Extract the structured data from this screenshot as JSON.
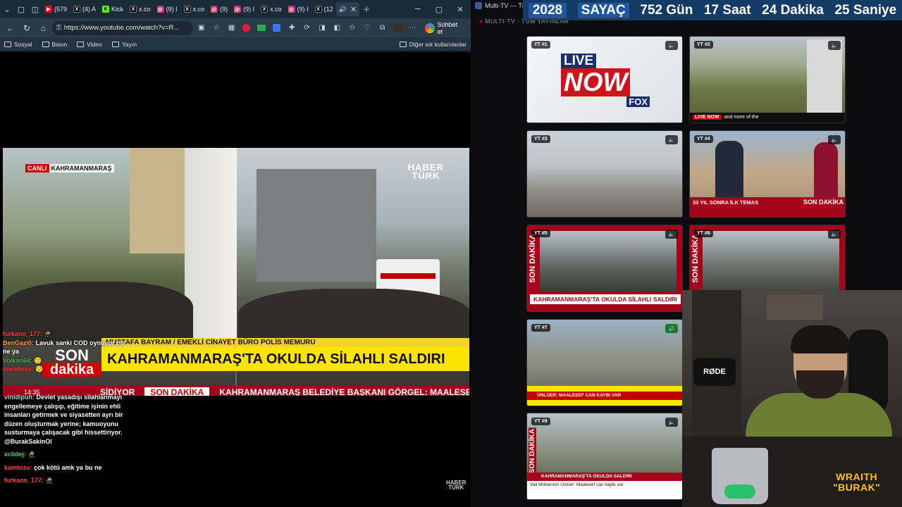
{
  "browser": {
    "tabs": [
      {
        "icon": "yt",
        "label": "(579"
      },
      {
        "icon": "x",
        "label": "(4) A"
      },
      {
        "icon": "kick",
        "label": "Kick"
      },
      {
        "icon": "x",
        "label": "x.co"
      },
      {
        "icon": "ig",
        "label": "(9) I"
      },
      {
        "icon": "x",
        "label": "x.co"
      },
      {
        "icon": "ig",
        "label": "(9)"
      },
      {
        "icon": "ig",
        "label": "(9) I"
      },
      {
        "icon": "x",
        "label": "x.co"
      },
      {
        "icon": "ig",
        "label": "(9) I"
      },
      {
        "icon": "x",
        "label": "(12"
      }
    ],
    "url": "https://www.youtube.com/watch?v=R...",
    "sohbet_label": "Sohbet et",
    "bookmarks": [
      "Sosyal",
      "Basın",
      "Video",
      "Yayın"
    ],
    "other_bookmarks": "Diğer sık kullanılanlar"
  },
  "video": {
    "live_tag": "CANLI",
    "location": "KAHRAMANMARAŞ",
    "logo_top": "HABER",
    "logo_bottom": "TÜRK",
    "guest_name": "MUSTAFA BAYRAM / EMEKLİ CİNAYET BÜRO POLİS MEMURU",
    "headline": "KAHRAMANMARAŞ'TA OKULDA SİLAHLI SALDIRI",
    "son_top": "SON",
    "son_bottom": "dakika",
    "ticker_left": "SİDİYOR",
    "ticker_tag": "SON DAKİKA",
    "ticker_text": "KAHRAMANMARAŞ BELEDİYE BAŞKANI GÖRGEL: MAALESEF",
    "clock": "14:35"
  },
  "chat": {
    "overlay_messages": [
      {
        "user": "furkann_177:",
        "text": "🥷"
      },
      {
        "user": "BenGazi0:",
        "text": "Lavuk sanki COD oynuyor bu ne ya"
      },
      {
        "user": "Volkan64:",
        "text": "🙂"
      },
      {
        "user": "emrebroz:",
        "text": "🙂"
      }
    ],
    "lower_messages": [
      {
        "user": "vinidipuh:",
        "text": "Devlet yasadışı silahlanmayı engellemeye çalışıp, eğitime işinin ehli insanları getirmek ve siyasetten ayrı bir düzen oluşturmak yerine; kamuoyunu susturmaya çalışacak gibi hissettiriyor. @BurakSakinOl"
      },
      {
        "user": "xclidej:",
        "text": "🥷"
      },
      {
        "user": "kamtozu:",
        "text": "çok kötü amk ya bu ne"
      },
      {
        "user": "furkann_177:",
        "text": "🥷"
      }
    ]
  },
  "stream": {
    "window_title": "Multi-TV — Tüm",
    "subtitle": "MULTI-TV · TÜM YAYINLAR",
    "counter": {
      "year": "2028",
      "label": "SAYAÇ",
      "days": "752 Gün",
      "hours": "17 Saat",
      "minutes": "24 Dakika",
      "seconds": "25 Saniye"
    },
    "tiles": [
      {
        "label": "YT #1",
        "text_a": "LIVE",
        "text_b": "NOW",
        "text_c": "FOX"
      },
      {
        "label": "YT #2",
        "text_a": "LIVE NOW",
        "text_b": "and more of the"
      },
      {
        "label": "YT #3"
      },
      {
        "label": "YT #4",
        "text_a": "33 YIL SONRA İLK TEMAS",
        "text_b": "SON DAKİKA"
      },
      {
        "label": "YT #5",
        "text_a": "SON DAKİKA",
        "text_b": "KAHRAMANMARAŞ'TA OKULDA SİLAHLI SALDIRI"
      },
      {
        "label": "YT #6",
        "text_a": "SON DAKİKA"
      },
      {
        "label": "YT #7",
        "text_a": "ÜNLÜER: MAALESEF CAN KAYBI VAR"
      },
      {
        "label": "YT #9",
        "text_a": "SON DAKİKA",
        "text_b": "KAHRAMANMARAŞ'TA OKULDA SALDIRI",
        "text_c": "Vali Mükerrem Ünlüer: Maalesef can kaybı var"
      }
    ],
    "cam": {
      "mic_brand": "RØDE",
      "brand_top": "WRAITH",
      "brand_bottom": "\"BURAK\""
    }
  }
}
